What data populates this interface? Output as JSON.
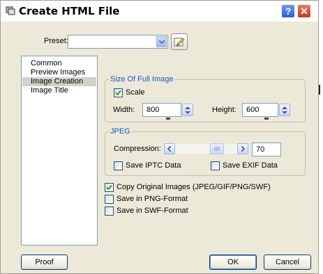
{
  "window": {
    "title": "Create HTML File"
  },
  "titlebar": {
    "help_glyph": "?",
    "close_glyph": "✕"
  },
  "preset": {
    "label": "Preset:",
    "value": ""
  },
  "sidebar": {
    "items": [
      "Common",
      "Preview Images",
      "Image Creation",
      "Image Title"
    ],
    "selected_index": 2
  },
  "size_group": {
    "legend": "Size Of Full Image",
    "scale_label": "Scale",
    "scale_checked": true,
    "width_label": "Width:",
    "width_value": "800",
    "height_label": "Height:",
    "height_value": "600"
  },
  "jpeg_group": {
    "legend": "JPEG",
    "compression_label": "Compression:",
    "compression_value": "70",
    "save_iptc_label": "Save IPTC Data",
    "save_iptc_checked": false,
    "save_exif_label": "Save EXIF Data",
    "save_exif_checked": false
  },
  "options": {
    "copy_original_label": "Copy Original Images (JPEG/GIF/PNG/SWF)",
    "copy_original_checked": true,
    "save_png_label": "Save in PNG-Format",
    "save_png_checked": false,
    "save_swf_label": "Save in SWF-Format",
    "save_swf_checked": false
  },
  "buttons": {
    "proof": "Proof",
    "ok": "OK",
    "cancel": "Cancel"
  },
  "colors": {
    "dialog_bg": "#ece9d8",
    "legend_text": "#1956c8",
    "check_mark": "#21a121",
    "close_red": "#c4391c"
  }
}
